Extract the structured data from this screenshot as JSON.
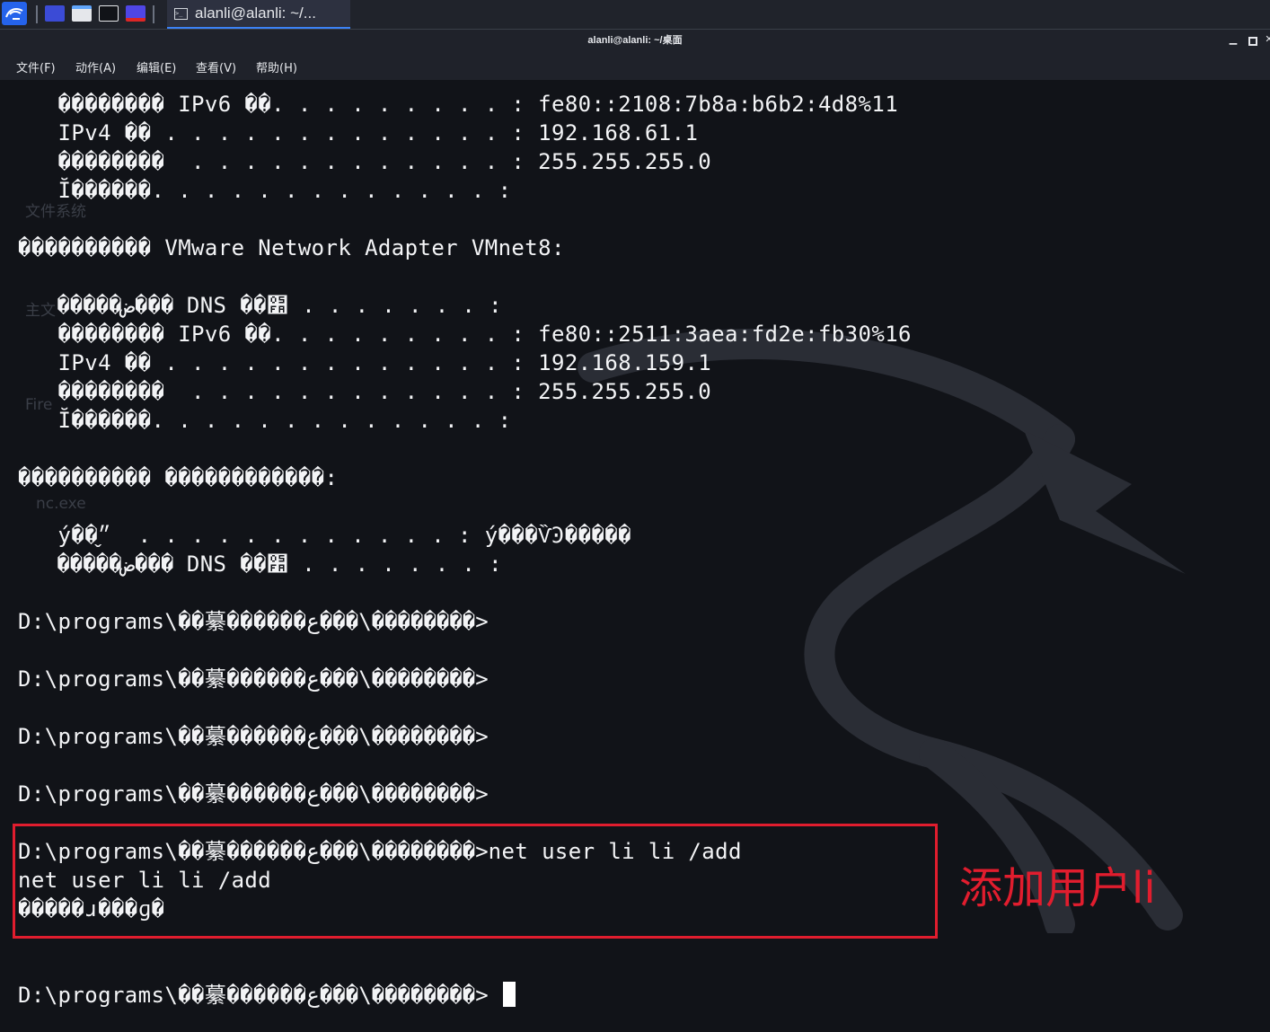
{
  "taskbar": {
    "active_task_title": "alanli@alanli: ~/..."
  },
  "window": {
    "title": "alanli@alanli: ~/桌面",
    "menu": [
      "文件(F)",
      "动作(A)",
      "编辑(E)",
      "查看(V)",
      "帮助(H)"
    ]
  },
  "desktop_ghost_labels": [
    "文件系统",
    "主文",
    "Fire",
    "nc.exe"
  ],
  "terminal": {
    "lines": [
      "   �������� IPv6 ��. . . . . . . . . : fe80::2108:7b8a:b6b2:4d8%11",
      "   IPv4 �� . . . . . . . . . . . . . : 192.168.61.1",
      "   ��������  . . . . . . . . . . . . : 255.255.255.0",
      "   Ĭ������. . . . . . . . . . . . . :",
      "",
      "���������� VMware Network Adapter VMnet8:",
      "",
      "   �����ض��� DNS ��׺ . . . . . . . :",
      "   �������� IPv6 ��. . . . . . . . . : fe80::2511:3aea:fd2e:fb30%16",
      "   IPv4 �� . . . . . . . . . . . . . : 192.168.159.1",
      "   ��������  . . . . . . . . . . . . : 255.255.255.0",
      "   Ĭ������. . . . . . . . . . . . . :",
      "",
      "���������� ������������:",
      "",
      "   ý��״̬  . . . . . . . . . . . . : ý���ѶϿ�����",
      "   �����ض��� DNS ��׺ . . . . . . . :",
      "",
      "D:\\programs\\��繤������ع���\\��������>",
      "",
      "D:\\programs\\��繤������ع���\\��������>",
      "",
      "D:\\programs\\��繤������ع���\\��������>",
      "",
      "D:\\programs\\��繤������ع���\\��������>",
      "",
      "D:\\programs\\��繤������ع���\\��������>net user li li /add",
      "net user li li /add",
      "�����ɹ���ɡ�",
      "",
      "",
      "D:\\programs\\��繤������ع���\\��������>"
    ]
  },
  "annotation": {
    "text": "添加用户li",
    "color": "#e11d2e"
  }
}
